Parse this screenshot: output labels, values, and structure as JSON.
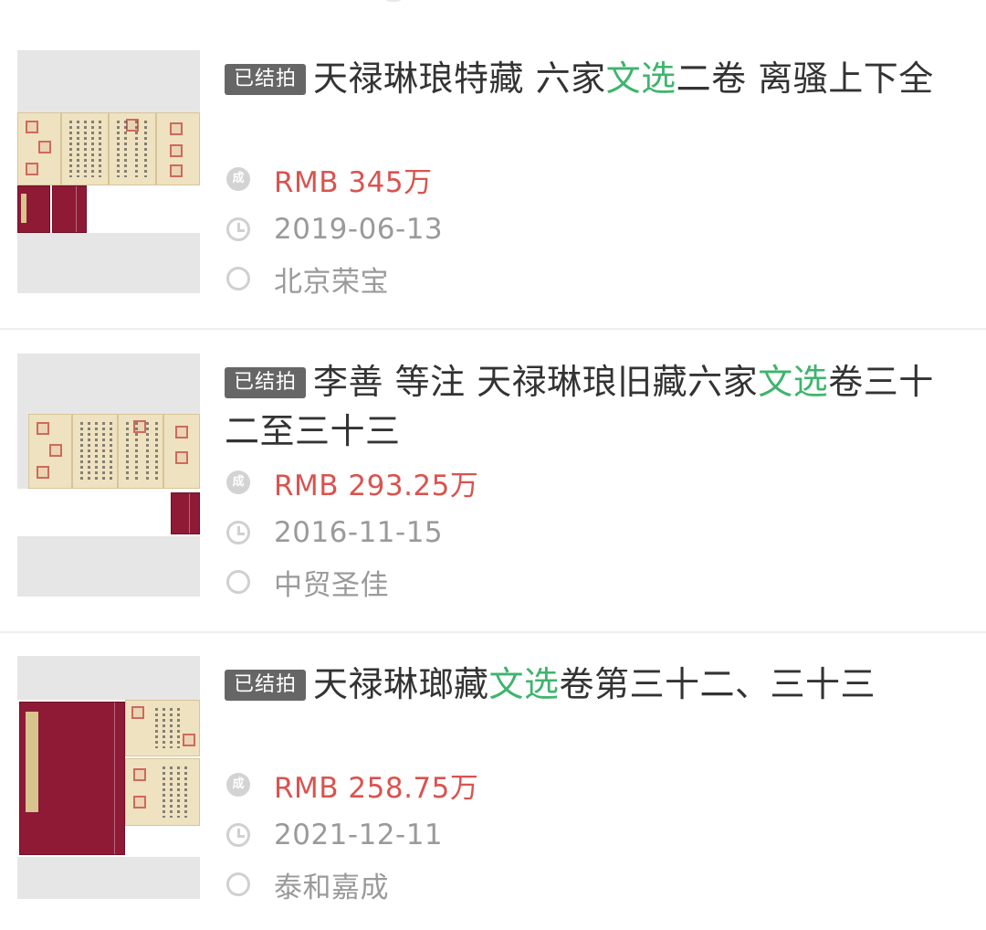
{
  "status_badge": "已结拍",
  "items": [
    {
      "title_before": "天禄琳琅特藏 六家",
      "title_highlight": "文选",
      "title_after": "二卷 离骚上下全",
      "price": "RMB 345万",
      "date": "2019-06-13",
      "auction_house": "北京荣宝"
    },
    {
      "title_before": "李善 等注 天禄琳琅旧藏六家",
      "title_highlight": "文选",
      "title_after": "卷三十二至三十三",
      "price": "RMB 293.25万",
      "date": "2016-11-15",
      "auction_house": "中贸圣佳"
    },
    {
      "title_before": "天禄琳瑯藏",
      "title_highlight": "文选",
      "title_after": "卷第三十二、三十三",
      "price": "RMB 258.75万",
      "date": "2021-12-11",
      "auction_house": "泰和嘉成"
    }
  ],
  "icons": {
    "deal": "deal-icon",
    "deal_glyph": "成",
    "clock": "clock-icon",
    "location": "location-icon"
  },
  "colors": {
    "highlight": "#3fb46d",
    "price": "#d9534f",
    "badge_bg": "#666666",
    "meta_text": "#9a9a9a"
  }
}
